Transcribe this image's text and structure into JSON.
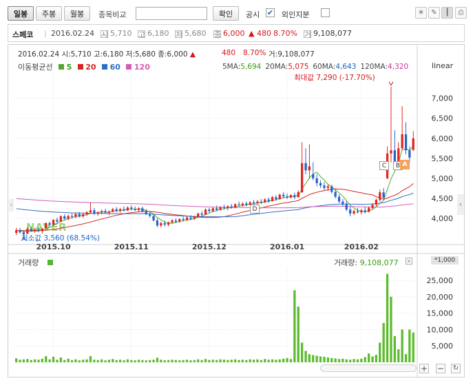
{
  "toolbar": {
    "period_buttons": [
      "일봉",
      "주봉",
      "월봉"
    ],
    "compare_label": "종목비교",
    "compare_input_value": "",
    "confirm_button": "확인",
    "disclosure_label": "공시",
    "disclosure_checked": true,
    "foreign_label": "외인지분",
    "foreign_checked": false
  },
  "stock_info": {
    "name": "스페코",
    "date": "2016.02.24",
    "open_icon": "시",
    "open": "5,710",
    "high_icon": "고",
    "high": "6,180",
    "low_icon": "저",
    "low": "5,680",
    "close_icon": "종",
    "close": "6,000",
    "change_arrow": "▲",
    "change": "480",
    "change_pct": "8.70%",
    "volume_icon": "거",
    "volume": "9,108,077"
  },
  "price_header": {
    "line": "2016.02.24 시:5,710 고:6,180 저:5,680 종:6,000",
    "change": "480",
    "change_pct": "8.70%",
    "volume": "거:9,108,077"
  },
  "ma_legend": {
    "title": "이동평균선",
    "items": [
      {
        "label": "5",
        "color": "#56a532"
      },
      {
        "label": "20",
        "color": "#d0281f"
      },
      {
        "label": "60",
        "color": "#2e6fc6"
      },
      {
        "label": "120",
        "color": "#d55bb5"
      }
    ],
    "values": [
      {
        "label": "5MA:",
        "value": "5,694",
        "color": "#3a9a10"
      },
      {
        "label": "20MA:",
        "value": "5,075",
        "color": "#d0281f"
      },
      {
        "label": "60MA:",
        "value": "4,643",
        "color": "#2e6fc6"
      },
      {
        "label": "120MA:",
        "value": "4,320",
        "color": "#c9359e"
      }
    ]
  },
  "scale_label": "linear",
  "annotations": {
    "max": "최대값 7,290 (-17.70%)",
    "min": "최소값 3,560 (68.54%)",
    "watermark": "NAVER",
    "markers": [
      "C",
      "B",
      "A",
      "D"
    ]
  },
  "volume_panel": {
    "title": "거래량",
    "value_label": "거래량:",
    "value": "9,108,077",
    "unit": "*1,000"
  },
  "chart_data": {
    "type": "candlestick",
    "x_ticks": [
      "2015.10",
      "2015.11",
      "2015.12",
      "2016.01",
      "2016.02"
    ],
    "y_ticks": [
      4000,
      4500,
      5000,
      5500,
      6000,
      6500,
      7000
    ],
    "ylim": [
      3500,
      7700
    ],
    "volume_ticks": [
      5000,
      10000,
      15000,
      20000,
      25000
    ],
    "volume_ylim": [
      0,
      29000
    ],
    "candles": [
      {
        "date": "09.14",
        "o": 3640,
        "h": 3760,
        "l": 3580,
        "c": 3700
      },
      {
        "date": "09.15",
        "o": 3700,
        "h": 3760,
        "l": 3620,
        "c": 3650
      },
      {
        "date": "09.16",
        "o": 3650,
        "h": 3700,
        "l": 3560,
        "c": 3600
      },
      {
        "date": "09.17",
        "o": 3620,
        "h": 3780,
        "l": 3600,
        "c": 3740
      },
      {
        "date": "09.18",
        "o": 3740,
        "h": 3800,
        "l": 3660,
        "c": 3690
      },
      {
        "date": "09.21",
        "o": 3700,
        "h": 3760,
        "l": 3640,
        "c": 3720
      },
      {
        "date": "09.22",
        "o": 3720,
        "h": 3780,
        "l": 3650,
        "c": 3680
      },
      {
        "date": "09.23",
        "o": 3680,
        "h": 3760,
        "l": 3620,
        "c": 3740
      },
      {
        "date": "09.24",
        "o": 3760,
        "h": 3900,
        "l": 3740,
        "c": 3880
      },
      {
        "date": "09.25",
        "o": 3880,
        "h": 3920,
        "l": 3800,
        "c": 3840
      },
      {
        "date": "10.01",
        "o": 3840,
        "h": 3980,
        "l": 3820,
        "c": 3960
      },
      {
        "date": "10.02",
        "o": 3960,
        "h": 4020,
        "l": 3880,
        "c": 3920
      },
      {
        "date": "10.05",
        "o": 3920,
        "h": 4080,
        "l": 3900,
        "c": 4050
      },
      {
        "date": "10.06",
        "o": 4050,
        "h": 4100,
        "l": 3960,
        "c": 3990
      },
      {
        "date": "10.07",
        "o": 3990,
        "h": 4090,
        "l": 3950,
        "c": 4060
      },
      {
        "date": "10.08",
        "o": 4060,
        "h": 4120,
        "l": 4000,
        "c": 4040
      },
      {
        "date": "10.12",
        "o": 4040,
        "h": 4140,
        "l": 4000,
        "c": 4110
      },
      {
        "date": "10.13",
        "o": 4110,
        "h": 4160,
        "l": 4020,
        "c": 4050
      },
      {
        "date": "10.14",
        "o": 4050,
        "h": 4130,
        "l": 4010,
        "c": 4100
      },
      {
        "date": "10.15",
        "o": 4100,
        "h": 4180,
        "l": 4060,
        "c": 4150
      },
      {
        "date": "10.16",
        "o": 4150,
        "h": 4400,
        "l": 4120,
        "c": 4200
      },
      {
        "date": "10.19",
        "o": 4200,
        "h": 4260,
        "l": 4080,
        "c": 4120
      },
      {
        "date": "10.20",
        "o": 4120,
        "h": 4180,
        "l": 4060,
        "c": 4150
      },
      {
        "date": "10.21",
        "o": 4150,
        "h": 4220,
        "l": 4100,
        "c": 4180
      },
      {
        "date": "10.22",
        "o": 4180,
        "h": 4240,
        "l": 4120,
        "c": 4140
      },
      {
        "date": "10.23",
        "o": 4140,
        "h": 4200,
        "l": 4080,
        "c": 4170
      },
      {
        "date": "10.26",
        "o": 4170,
        "h": 4260,
        "l": 4150,
        "c": 4230
      },
      {
        "date": "10.27",
        "o": 4230,
        "h": 4280,
        "l": 4160,
        "c": 4190
      },
      {
        "date": "10.28",
        "o": 4190,
        "h": 4260,
        "l": 4140,
        "c": 4230
      },
      {
        "date": "10.29",
        "o": 4230,
        "h": 4300,
        "l": 4170,
        "c": 4200
      },
      {
        "date": "10.30",
        "o": 4200,
        "h": 4300,
        "l": 4180,
        "c": 4270
      },
      {
        "date": "11.02",
        "o": 4270,
        "h": 4320,
        "l": 4200,
        "c": 4240
      },
      {
        "date": "11.03",
        "o": 4240,
        "h": 4300,
        "l": 4180,
        "c": 4210
      },
      {
        "date": "11.04",
        "o": 4210,
        "h": 4280,
        "l": 4160,
        "c": 4250
      },
      {
        "date": "11.05",
        "o": 4250,
        "h": 4300,
        "l": 4150,
        "c": 4180
      },
      {
        "date": "11.06",
        "o": 4180,
        "h": 4230,
        "l": 4080,
        "c": 4100
      },
      {
        "date": "11.09",
        "o": 4100,
        "h": 4160,
        "l": 4020,
        "c": 4060
      },
      {
        "date": "11.10",
        "o": 4060,
        "h": 4100,
        "l": 3920,
        "c": 3950
      },
      {
        "date": "11.11",
        "o": 3950,
        "h": 4000,
        "l": 3780,
        "c": 3820
      },
      {
        "date": "11.12",
        "o": 3820,
        "h": 3920,
        "l": 3780,
        "c": 3880
      },
      {
        "date": "11.13",
        "o": 3880,
        "h": 3940,
        "l": 3800,
        "c": 3840
      },
      {
        "date": "11.16",
        "o": 3840,
        "h": 3920,
        "l": 3800,
        "c": 3900
      },
      {
        "date": "11.17",
        "o": 3900,
        "h": 3980,
        "l": 3860,
        "c": 3950
      },
      {
        "date": "11.18",
        "o": 3950,
        "h": 4000,
        "l": 3880,
        "c": 3920
      },
      {
        "date": "11.19",
        "o": 3920,
        "h": 4000,
        "l": 3890,
        "c": 3980
      },
      {
        "date": "11.20",
        "o": 3980,
        "h": 4040,
        "l": 3920,
        "c": 3960
      },
      {
        "date": "11.23",
        "o": 3960,
        "h": 4050,
        "l": 3930,
        "c": 4020
      },
      {
        "date": "11.24",
        "o": 4020,
        "h": 4080,
        "l": 3950,
        "c": 3990
      },
      {
        "date": "11.25",
        "o": 3990,
        "h": 4060,
        "l": 3960,
        "c": 4040
      },
      {
        "date": "11.26",
        "o": 4040,
        "h": 4140,
        "l": 4020,
        "c": 4120
      },
      {
        "date": "11.27",
        "o": 4120,
        "h": 4180,
        "l": 4050,
        "c": 4090
      },
      {
        "date": "11.30",
        "o": 4090,
        "h": 4250,
        "l": 4080,
        "c": 4220
      },
      {
        "date": "12.01",
        "o": 4220,
        "h": 4260,
        "l": 4140,
        "c": 4180
      },
      {
        "date": "12.02",
        "o": 4180,
        "h": 4280,
        "l": 4160,
        "c": 4250
      },
      {
        "date": "12.03",
        "o": 4250,
        "h": 4320,
        "l": 4180,
        "c": 4210
      },
      {
        "date": "12.04",
        "o": 4210,
        "h": 4300,
        "l": 4200,
        "c": 4280
      },
      {
        "date": "12.07",
        "o": 4280,
        "h": 4340,
        "l": 4220,
        "c": 4260
      },
      {
        "date": "12.08",
        "o": 4260,
        "h": 4330,
        "l": 4200,
        "c": 4300
      },
      {
        "date": "12.09",
        "o": 4300,
        "h": 4360,
        "l": 4240,
        "c": 4270
      },
      {
        "date": "12.10",
        "o": 4270,
        "h": 4380,
        "l": 4250,
        "c": 4350
      },
      {
        "date": "12.11",
        "o": 4350,
        "h": 4420,
        "l": 4300,
        "c": 4330
      },
      {
        "date": "12.14",
        "o": 4330,
        "h": 4400,
        "l": 4290,
        "c": 4370
      },
      {
        "date": "12.15",
        "o": 4370,
        "h": 4420,
        "l": 4300,
        "c": 4340
      },
      {
        "date": "12.16",
        "o": 4340,
        "h": 4430,
        "l": 4320,
        "c": 4400
      },
      {
        "date": "12.17",
        "o": 4400,
        "h": 4460,
        "l": 4340,
        "c": 4380
      },
      {
        "date": "12.18",
        "o": 4380,
        "h": 4460,
        "l": 4350,
        "c": 4420
      },
      {
        "date": "12.21",
        "o": 4420,
        "h": 4480,
        "l": 4360,
        "c": 4400
      },
      {
        "date": "12.22",
        "o": 4400,
        "h": 4500,
        "l": 4380,
        "c": 4470
      },
      {
        "date": "12.23",
        "o": 4470,
        "h": 4520,
        "l": 4390,
        "c": 4430
      },
      {
        "date": "12.24",
        "o": 4430,
        "h": 4560,
        "l": 4420,
        "c": 4530
      },
      {
        "date": "12.28",
        "o": 4530,
        "h": 4580,
        "l": 4440,
        "c": 4480
      },
      {
        "date": "12.29",
        "o": 4480,
        "h": 4620,
        "l": 4460,
        "c": 4590
      },
      {
        "date": "12.30",
        "o": 4590,
        "h": 4660,
        "l": 4500,
        "c": 4550
      },
      {
        "date": "01.04",
        "o": 4550,
        "h": 4620,
        "l": 4480,
        "c": 4520
      },
      {
        "date": "01.05",
        "o": 4520,
        "h": 4600,
        "l": 4500,
        "c": 4580
      },
      {
        "date": "01.06",
        "o": 4580,
        "h": 4640,
        "l": 4480,
        "c": 4530
      },
      {
        "date": "01.07",
        "o": 4530,
        "h": 4700,
        "l": 4520,
        "c": 4650
      },
      {
        "date": "01.08",
        "o": 4650,
        "h": 5900,
        "l": 4640,
        "c": 5380
      },
      {
        "date": "01.11",
        "o": 5380,
        "h": 5750,
        "l": 5100,
        "c": 5200
      },
      {
        "date": "01.12",
        "o": 5200,
        "h": 5850,
        "l": 5000,
        "c": 5300
      },
      {
        "date": "01.13",
        "o": 5100,
        "h": 5400,
        "l": 4950,
        "c": 5000
      },
      {
        "date": "01.14",
        "o": 5000,
        "h": 5100,
        "l": 4800,
        "c": 4880
      },
      {
        "date": "01.15",
        "o": 4880,
        "h": 4950,
        "l": 4760,
        "c": 4820
      },
      {
        "date": "01.18",
        "o": 4820,
        "h": 4900,
        "l": 4700,
        "c": 4760
      },
      {
        "date": "01.19",
        "o": 4760,
        "h": 4860,
        "l": 4680,
        "c": 4800
      },
      {
        "date": "01.20",
        "o": 4800,
        "h": 4840,
        "l": 4620,
        "c": 4660
      },
      {
        "date": "01.21",
        "o": 4660,
        "h": 4720,
        "l": 4500,
        "c": 4540
      },
      {
        "date": "01.22",
        "o": 4540,
        "h": 4600,
        "l": 4380,
        "c": 4420
      },
      {
        "date": "01.25",
        "o": 4420,
        "h": 4480,
        "l": 4300,
        "c": 4350
      },
      {
        "date": "01.26",
        "o": 4350,
        "h": 4420,
        "l": 4180,
        "c": 4220
      },
      {
        "date": "01.27",
        "o": 4220,
        "h": 4300,
        "l": 4050,
        "c": 4120
      },
      {
        "date": "01.28",
        "o": 4120,
        "h": 4220,
        "l": 4080,
        "c": 4180
      },
      {
        "date": "01.29",
        "o": 4180,
        "h": 4260,
        "l": 4120,
        "c": 4150
      },
      {
        "date": "02.01",
        "o": 4150,
        "h": 4240,
        "l": 4100,
        "c": 4200
      },
      {
        "date": "02.02",
        "o": 4200,
        "h": 4280,
        "l": 4120,
        "c": 4160
      },
      {
        "date": "02.03",
        "o": 4160,
        "h": 4300,
        "l": 4150,
        "c": 4260
      },
      {
        "date": "02.04",
        "o": 4260,
        "h": 4380,
        "l": 4220,
        "c": 4340
      },
      {
        "date": "02.05",
        "o": 4340,
        "h": 4500,
        "l": 4300,
        "c": 4460
      },
      {
        "date": "02.11",
        "o": 4460,
        "h": 4720,
        "l": 4420,
        "c": 4650
      },
      {
        "date": "02.12",
        "o": 4650,
        "h": 4760,
        "l": 4460,
        "c": 4520
      },
      {
        "date": "02.15",
        "o": 5000,
        "h": 5800,
        "l": 4980,
        "c": 5620
      },
      {
        "date": "02.16",
        "o": 5620,
        "h": 7290,
        "l": 5400,
        "c": 5700
      },
      {
        "date": "02.17",
        "o": 5700,
        "h": 6200,
        "l": 5300,
        "c": 5400
      },
      {
        "date": "02.18",
        "o": 5400,
        "h": 5900,
        "l": 5200,
        "c": 5750
      },
      {
        "date": "02.19",
        "o": 5750,
        "h": 6800,
        "l": 5700,
        "c": 6100
      },
      {
        "date": "02.22",
        "o": 6100,
        "h": 6400,
        "l": 5600,
        "c": 5700
      },
      {
        "date": "02.23",
        "o": 5700,
        "h": 5800,
        "l": 5400,
        "c": 5520
      },
      {
        "date": "02.24",
        "o": 5710,
        "h": 6180,
        "l": 5680,
        "c": 6000
      }
    ],
    "volume": [
      1200,
      800,
      900,
      1000,
      700,
      900,
      800,
      1100,
      1900,
      900,
      1700,
      800,
      1500,
      700,
      1100,
      700,
      900,
      600,
      800,
      900,
      1900,
      800,
      700,
      900,
      600,
      800,
      1000,
      700,
      800,
      600,
      900,
      700,
      600,
      800,
      700,
      600,
      700,
      800,
      1400,
      800,
      600,
      700,
      800,
      700,
      600,
      700,
      800,
      600,
      700,
      900,
      700,
      1000,
      700,
      800,
      700,
      900,
      800,
      700,
      800,
      900,
      700,
      800,
      700,
      900,
      800,
      900,
      700,
      1000,
      800,
      900,
      800,
      900,
      1100,
      1300,
      1000,
      22000,
      17000,
      6000,
      3500,
      2500,
      2200,
      2000,
      1800,
      1700,
      1500,
      1300,
      1200,
      1000,
      1100,
      900,
      800,
      1000,
      900,
      1100,
      1600,
      2700,
      1800,
      2300,
      6000,
      12000,
      27000,
      20000,
      8000,
      4000,
      10000,
      2500,
      10000,
      9108
    ]
  }
}
